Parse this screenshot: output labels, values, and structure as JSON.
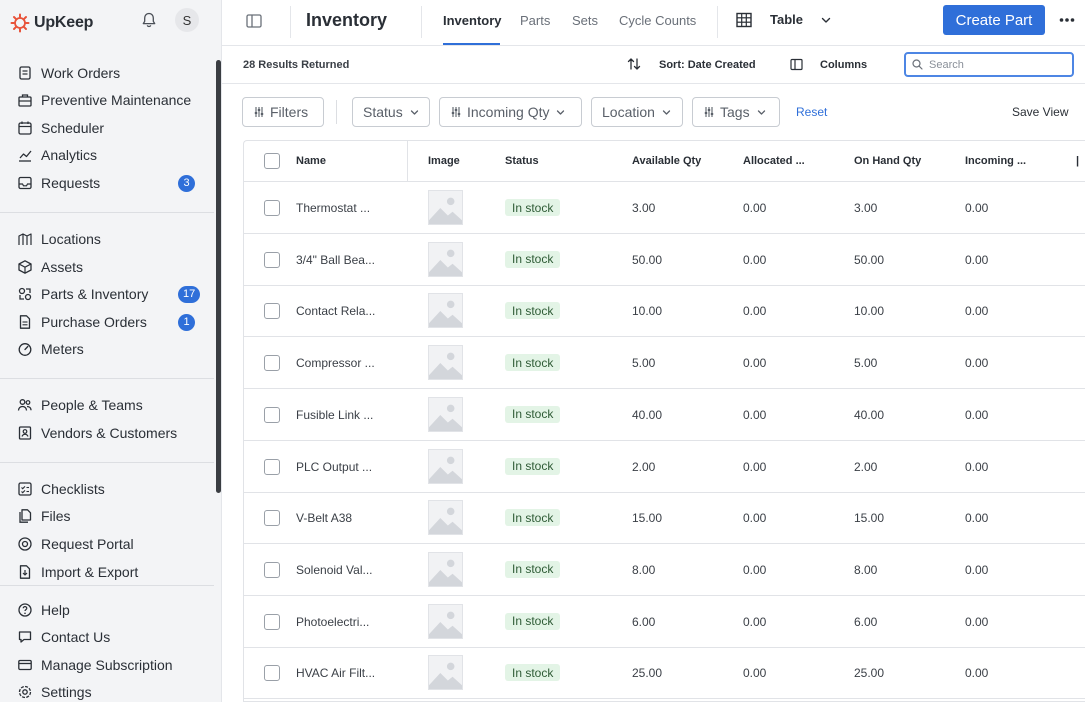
{
  "brand": {
    "name": "UpKeep",
    "accent": "#e8533a"
  },
  "user": {
    "initial": "S"
  },
  "sidebar": {
    "groups": [
      [
        {
          "label": "Work Orders",
          "icon": "work-orders-icon"
        },
        {
          "label": "Preventive Maintenance",
          "icon": "preventive-maintenance-icon"
        },
        {
          "label": "Scheduler",
          "icon": "calendar-icon"
        },
        {
          "label": "Analytics",
          "icon": "analytics-icon"
        },
        {
          "label": "Requests",
          "icon": "inbox-icon",
          "badge": "3"
        }
      ],
      [
        {
          "label": "Locations",
          "icon": "locations-icon"
        },
        {
          "label": "Assets",
          "icon": "cube-icon"
        },
        {
          "label": "Parts & Inventory",
          "icon": "parts-icon",
          "badge": "17"
        },
        {
          "label": "Purchase Orders",
          "icon": "document-icon",
          "badge": "1"
        },
        {
          "label": "Meters",
          "icon": "meter-icon"
        }
      ],
      [
        {
          "label": "People & Teams",
          "icon": "people-icon"
        },
        {
          "label": "Vendors & Customers",
          "icon": "vendors-icon"
        }
      ],
      [
        {
          "label": "Checklists",
          "icon": "checklist-icon"
        },
        {
          "label": "Files",
          "icon": "files-icon"
        },
        {
          "label": "Request Portal",
          "icon": "portal-icon"
        },
        {
          "label": "Import & Export",
          "icon": "import-export-icon"
        }
      ],
      [
        {
          "label": "Help",
          "icon": "help-icon"
        },
        {
          "label": "Contact Us",
          "icon": "chat-icon"
        },
        {
          "label": "Manage Subscription",
          "icon": "subscription-icon"
        },
        {
          "label": "Settings",
          "icon": "gear-icon"
        }
      ]
    ]
  },
  "header": {
    "title": "Inventory",
    "tabs": [
      {
        "label": "Inventory",
        "active": true
      },
      {
        "label": "Parts",
        "active": false
      },
      {
        "label": "Sets",
        "active": false
      },
      {
        "label": "Cycle Counts",
        "active": false
      }
    ],
    "view_label": "Table",
    "create_label": "Create Part"
  },
  "toolbar": {
    "results": "28 Results Returned",
    "sort_label": "Sort: Date Created",
    "columns_label": "Columns",
    "search_placeholder": "Search"
  },
  "filters": {
    "buttons": [
      {
        "label": "Filters",
        "icon": true,
        "chevron": false
      },
      {
        "label": "Status",
        "icon": false,
        "chevron": true
      },
      {
        "label": "Incoming Qty",
        "icon": true,
        "chevron": true
      },
      {
        "label": "Location",
        "icon": false,
        "chevron": true
      },
      {
        "label": "Tags",
        "icon": true,
        "chevron": true
      }
    ],
    "reset_label": "Reset",
    "save_view_label": "Save View"
  },
  "table": {
    "columns": [
      "Name",
      "Image",
      "Status",
      "Available Qty",
      "Allocated ...",
      "On Hand Qty",
      "Incoming ..."
    ],
    "rows": [
      {
        "name": "Thermostat ...",
        "status": "In stock",
        "available": "3.00",
        "allocated": "0.00",
        "on_hand": "3.00",
        "incoming": "0.00"
      },
      {
        "name": "3/4\" Ball Bea...",
        "status": "In stock",
        "available": "50.00",
        "allocated": "0.00",
        "on_hand": "50.00",
        "incoming": "0.00"
      },
      {
        "name": "Contact Rela...",
        "status": "In stock",
        "available": "10.00",
        "allocated": "0.00",
        "on_hand": "10.00",
        "incoming": "0.00"
      },
      {
        "name": "Compressor ...",
        "status": "In stock",
        "available": "5.00",
        "allocated": "0.00",
        "on_hand": "5.00",
        "incoming": "0.00"
      },
      {
        "name": "Fusible Link ...",
        "status": "In stock",
        "available": "40.00",
        "allocated": "0.00",
        "on_hand": "40.00",
        "incoming": "0.00"
      },
      {
        "name": "PLC Output ...",
        "status": "In stock",
        "available": "2.00",
        "allocated": "0.00",
        "on_hand": "2.00",
        "incoming": "0.00"
      },
      {
        "name": "V-Belt A38",
        "status": "In stock",
        "available": "15.00",
        "allocated": "0.00",
        "on_hand": "15.00",
        "incoming": "0.00"
      },
      {
        "name": "Solenoid Val...",
        "status": "In stock",
        "available": "8.00",
        "allocated": "0.00",
        "on_hand": "8.00",
        "incoming": "0.00"
      },
      {
        "name": "Photoelectri...",
        "status": "In stock",
        "available": "6.00",
        "allocated": "0.00",
        "on_hand": "6.00",
        "incoming": "0.00"
      },
      {
        "name": "HVAC Air Filt...",
        "status": "In stock",
        "available": "25.00",
        "allocated": "0.00",
        "on_hand": "25.00",
        "incoming": "0.00"
      }
    ]
  },
  "colors": {
    "primary": "#2f6fd9",
    "status_bg": "#e3f4e6",
    "status_text": "#2e5b35",
    "sidebar_bg": "#f3f4f6"
  }
}
